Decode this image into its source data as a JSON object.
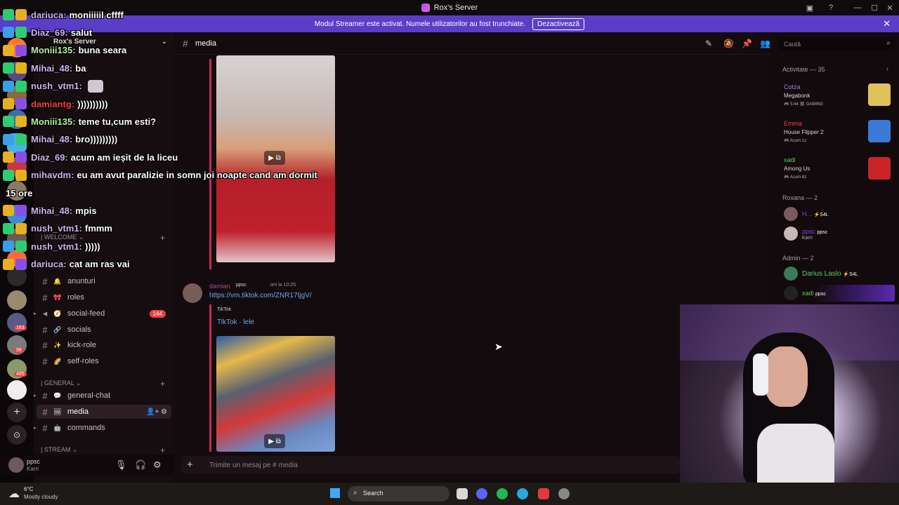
{
  "titlebar": {
    "title": "Rox's Server"
  },
  "banner": {
    "text": "Modul Streamer este activat. Numele utilizatorilor au fost trunchiate.",
    "button": "Dezactivează"
  },
  "guilds": {
    "badges": [
      "163",
      "98",
      "485"
    ]
  },
  "channels": {
    "server_name": "Rox's Server",
    "items": [
      {
        "label": "anunturi",
        "emoji": "🔔"
      },
      {
        "label": "roles",
        "emoji": "🎀"
      },
      {
        "label": "social-feed",
        "emoji": "🧭",
        "badge": "144"
      },
      {
        "label": "socials",
        "emoji": "🔗"
      },
      {
        "label": "kick-role",
        "emoji": "✨"
      },
      {
        "label": "self-roles",
        "emoji": "🌈"
      },
      {
        "label": "general-chat",
        "emoji": "💬"
      },
      {
        "label": "media",
        "emoji": "🖼"
      },
      {
        "label": "commands",
        "emoji": "🤖"
      }
    ],
    "categories": {
      "welcome": "| WELCOME",
      "general": "| GENERAL",
      "stream": "| STREAM"
    }
  },
  "userbar": {
    "name": "ppsc",
    "status": "Karri"
  },
  "main": {
    "channel_name": "media",
    "message": {
      "author": "damian",
      "tag": "ppsc",
      "time": "ieri la 10:25",
      "link": "https://vm.tiktok.com/ZNR17tjgV/",
      "embed_provider": "TikTok",
      "embed_title": "TikTok · lele"
    },
    "composer_placeholder": "Trimite un mesaj pe #",
    "composer_channel": "media"
  },
  "members": {
    "search_placeholder": "Caută",
    "activity_header": "Activitate — 35",
    "activities": [
      {
        "user": "Cotza",
        "game": "Megabonk",
        "detail": "🎮 5:44 ⛓ GAMING",
        "color": "#9b84ee"
      },
      {
        "user": "Emma",
        "game": "House Flipper 2",
        "detail": "🎮 Acum 1z",
        "color": "#f23f43"
      },
      {
        "user": "xadi",
        "game": "Among Us",
        "detail": "🎮 Acum 8z",
        "color": "#5ad05a"
      }
    ],
    "groups": [
      {
        "header": "Roxana — 2",
        "members": [
          {
            "name": "H...",
            "tag": "⚡S4L",
            "color": "#8a3ee8"
          },
          {
            "name": "ppsc",
            "tag": "ppsc",
            "sub": "Karri",
            "color": "#8a3ee8"
          }
        ]
      },
      {
        "header": "Admin — 2",
        "members": [
          {
            "name": "Darius Laslo",
            "tag": "⚡S4L",
            "color": "#5ad05a"
          },
          {
            "name": "xadi",
            "tag": "ppsc",
            "color": "#5ad05a"
          }
        ]
      }
    ]
  },
  "overlay_chat": [
    {
      "user": "dariuca",
      "text": "moniiiiil cffff",
      "color": "#ccb4f0"
    },
    {
      "user": "Diaz_69",
      "text": "salut",
      "color": "#ccb4f0"
    },
    {
      "user": "Moniii135",
      "text": "buna seara",
      "color": "#b6f0a0"
    },
    {
      "user": "Mihai_48",
      "text": "ba",
      "color": "#ccb4f0"
    },
    {
      "user": "nush_vtm1",
      "text": "",
      "color": "#ccb4f0"
    },
    {
      "user": "damiantg",
      "text": "))))))))))",
      "color": "#f23f43"
    },
    {
      "user": "Moniii135",
      "text": "teme tu,cum esti?",
      "color": "#b6f0a0"
    },
    {
      "user": "Mihai_48",
      "text": "bro)))))))))",
      "color": "#ccb4f0"
    },
    {
      "user": "Diaz_69",
      "text": "acum am ieșit de la liceu",
      "color": "#ccb4f0"
    },
    {
      "user": "mihavdm",
      "text": "eu am avut paralizie in somn joi noapte cand am dormit",
      "color": "#ccb4f0"
    },
    {
      "user": "",
      "text": "15 ore",
      "color": "#ffffff"
    },
    {
      "user": "Mihai_48",
      "text": "mpis",
      "color": "#ccb4f0"
    },
    {
      "user": "nush_vtm1",
      "text": "fmmm",
      "color": "#ccb4f0"
    },
    {
      "user": "nush_vtm1",
      "text": ")))))",
      "color": "#ccb4f0"
    },
    {
      "user": "dariuca",
      "text": "cat am ras vai",
      "color": "#ccb4f0"
    }
  ],
  "taskbar": {
    "temp": "6°C",
    "weather": "Mostly cloudy",
    "search": "Search"
  }
}
